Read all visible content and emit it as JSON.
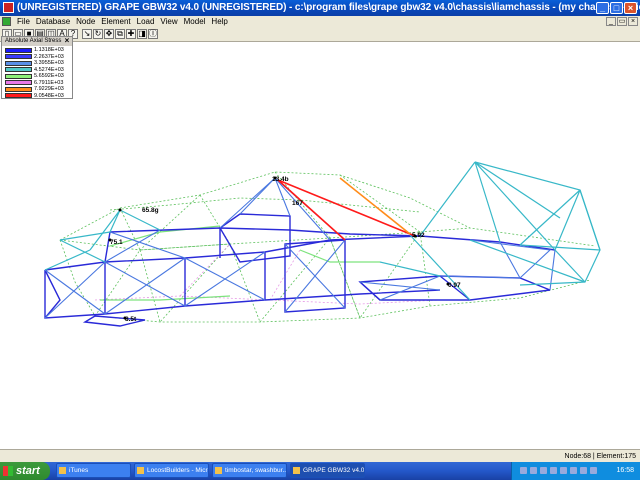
{
  "window": {
    "title": "(UNREGISTERED) GRAPE GBW32 v4.0 (UNREGISTERED)  - c:\\program files\\grape gbw32 v4.0\\chassis\\liamchassis - (my chassis) - [View 1]"
  },
  "title_buttons": {
    "minimize": "_",
    "maximize": "□",
    "close": "×"
  },
  "menu": [
    "File",
    "Database",
    "Node",
    "Element",
    "Load",
    "View",
    "Model",
    "Help"
  ],
  "child_window_buttons": {
    "minimize": "_",
    "restore": "▭",
    "close": "×"
  },
  "toolbar": {
    "buttons": [
      {
        "icon": "new-file-icon",
        "glyph": "▯"
      },
      {
        "icon": "open-folder-icon",
        "glyph": "▭"
      },
      {
        "icon": "save-icon",
        "glyph": "■"
      },
      {
        "icon": "print-icon",
        "glyph": "▤"
      },
      {
        "icon": "print-preview-icon",
        "glyph": "◫"
      },
      {
        "icon": "font-icon",
        "glyph": "A"
      },
      {
        "icon": "help-pointer-icon",
        "glyph": "?"
      },
      {
        "icon": "select-arrow-icon",
        "glyph": "↘"
      },
      {
        "icon": "rotate-icon",
        "glyph": "↻"
      },
      {
        "icon": "pan-icon",
        "glyph": "✥"
      },
      {
        "icon": "zoom-window-icon",
        "glyph": "⧉"
      },
      {
        "icon": "zoom-extents-icon",
        "glyph": "✚"
      },
      {
        "icon": "zoom-out-icon",
        "glyph": "◨"
      },
      {
        "icon": "zoom-realtime-icon",
        "glyph": "Ⓘ"
      }
    ]
  },
  "legend": {
    "title": "Absolute Axial Stress",
    "close": "×",
    "items": [
      {
        "value": "1.1318E+03",
        "color": "#1a1aff"
      },
      {
        "value": "2.2637E+03",
        "color": "#3a3aff"
      },
      {
        "value": "3.3955E+03",
        "color": "#5a8fe8"
      },
      {
        "value": "4.5274E+03",
        "color": "#4fc8c8"
      },
      {
        "value": "5.6592E+03",
        "color": "#8ef07a"
      },
      {
        "value": "6.7911E+03",
        "color": "#e878e8"
      },
      {
        "value": "7.9229E+03",
        "color": "#ff8c1a"
      },
      {
        "value": "9.0548E+03",
        "color": "#ff1a1a"
      }
    ]
  },
  "model": {
    "node_labels": [
      "65.8g",
      "167",
      "5.92",
      "75.1",
      "0.97",
      "8.5t",
      "13.4b"
    ]
  },
  "status": {
    "text": "Node:68 | Element:175"
  },
  "taskbar": {
    "start": "start",
    "tasks": [
      {
        "label": "iTunes",
        "active": false
      },
      {
        "label": "LocostBuilders - Micro...",
        "active": false
      },
      {
        "label": "timbostar, swashbur...",
        "active": false
      },
      {
        "label": "GRAPE GBW32 v4.0",
        "active": true
      }
    ],
    "clock": "16:58"
  }
}
